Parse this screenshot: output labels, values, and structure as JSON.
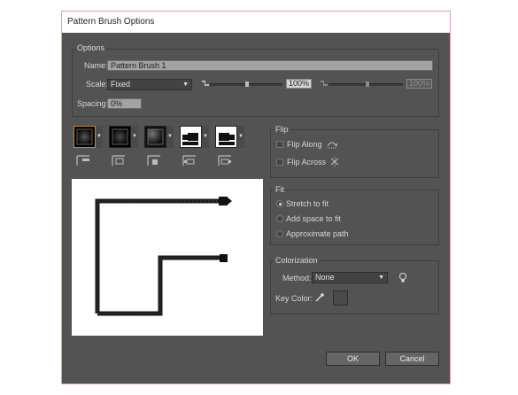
{
  "window": {
    "title": "Pattern Brush Options"
  },
  "options": {
    "group_label": "Options",
    "name_label": "Name:",
    "name_value": "Pattern Brush 1",
    "scale_label": "Scale:",
    "scale_value": "Fixed",
    "scale_pct_1": "100%",
    "scale_pct_2": "100%",
    "spacing_label": "Spacing:",
    "spacing_value": "0%"
  },
  "tiles": [
    {
      "id": "side-tile",
      "icon": "side-tile-icon"
    },
    {
      "id": "outer-corner-tile",
      "icon": "outer-corner-tile-icon"
    },
    {
      "id": "inner-corner-tile",
      "icon": "inner-corner-tile-icon"
    },
    {
      "id": "start-tile",
      "icon": "start-tile-icon"
    },
    {
      "id": "end-tile",
      "icon": "end-tile-icon"
    }
  ],
  "flip": {
    "group_label": "Flip",
    "along_label": "Flip Along",
    "across_label": "Flip Across",
    "along_checked": false,
    "across_checked": false
  },
  "fit": {
    "group_label": "Fit",
    "options": [
      "Stretch to fit",
      "Add space to fit",
      "Approximate path"
    ],
    "selected": "Stretch to fit"
  },
  "colorization": {
    "group_label": "Colorization",
    "method_label": "Method:",
    "method_value": "None",
    "key_color_label": "Key Color:"
  },
  "buttons": {
    "ok": "OK",
    "cancel": "Cancel"
  },
  "colors": {
    "dialog_bg": "#535353",
    "field_bg": "#a3a3a3",
    "preview_bg": "#ffffff"
  }
}
